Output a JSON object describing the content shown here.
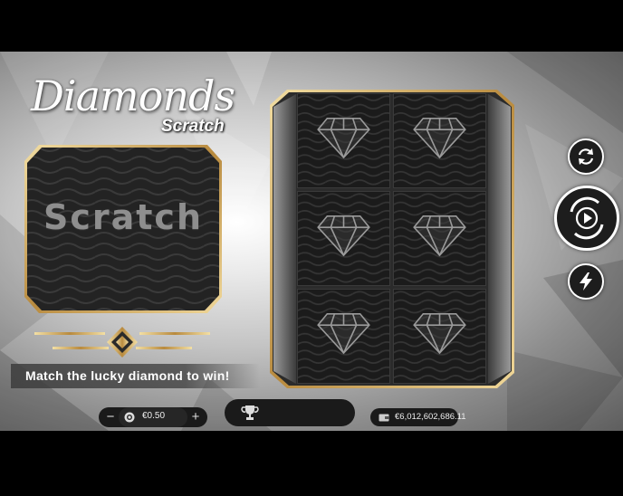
{
  "game": {
    "title_main": "Diamonds",
    "title_sub": "Scratch",
    "panel_label": "Scratch",
    "instruction": "Match the lucky diamond to win!"
  },
  "grid": {
    "rows": 3,
    "cols": 2,
    "cells": [
      {
        "icon": "diamond-icon"
      },
      {
        "icon": "diamond-icon"
      },
      {
        "icon": "diamond-icon"
      },
      {
        "icon": "diamond-icon"
      },
      {
        "icon": "diamond-icon"
      },
      {
        "icon": "diamond-icon"
      }
    ]
  },
  "controls": {
    "refresh_icon": "refresh-icon",
    "play_icon": "play-icon",
    "turbo_icon": "lightning-icon"
  },
  "bottom_bar": {
    "minus_label": "−",
    "plus_label": "+",
    "bet_value": "€0.50",
    "win_icon": "trophy-icon",
    "balance": "€6,012,602,686.11"
  },
  "colors": {
    "gold": "#c9a45c",
    "panel_dark": "#222222",
    "button_bg": "#1d1d1d"
  }
}
